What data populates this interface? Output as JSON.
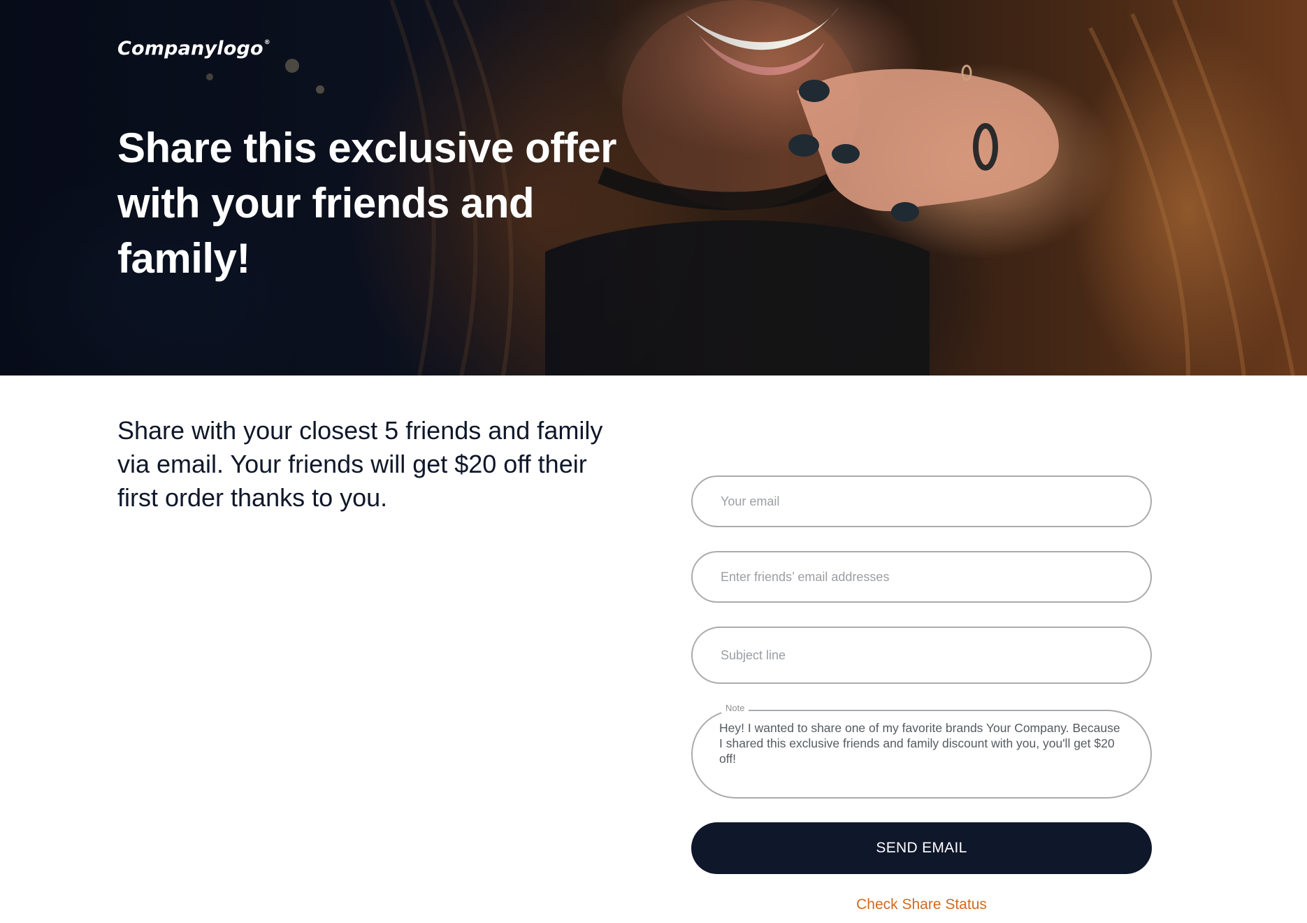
{
  "hero": {
    "logo_text": "Companylogo",
    "logo_mark": "®",
    "title": "Share this exclusive offer with your friends and family!"
  },
  "intro": {
    "text": "Share with your closest 5 friends and family via email. Your friends will get $20 off their first order thanks to you."
  },
  "form": {
    "your_email": {
      "placeholder": "Your email",
      "value": ""
    },
    "friends_emails": {
      "placeholder": "Enter friends’ email addresses",
      "value": ""
    },
    "subject": {
      "placeholder": "Subject line",
      "value": ""
    },
    "note": {
      "label": "Note",
      "value": "Hey! I wanted to share one of my favorite brands Your Company. Because I shared this exclusive friends and family discount with you, you'll get $20 off!"
    },
    "send_label": "SEND EMAIL",
    "status_link_label": "Check Share Status"
  },
  "colors": {
    "primary": "#0f172a",
    "link": "#d2691e",
    "field_border": "#a9abae"
  }
}
